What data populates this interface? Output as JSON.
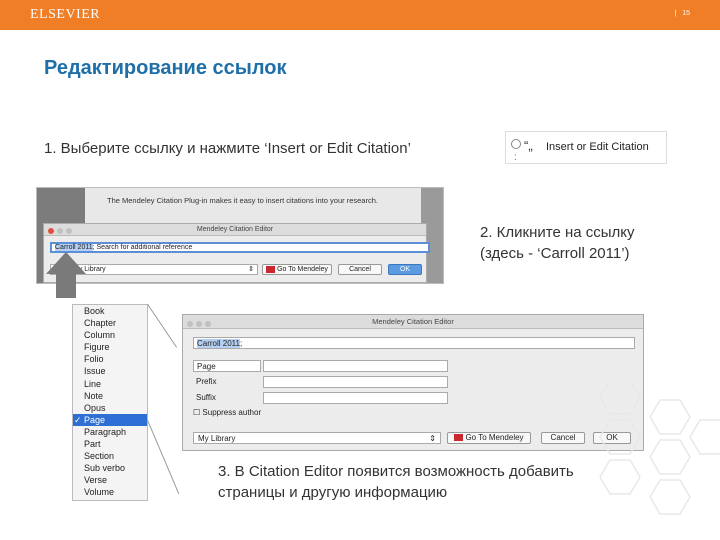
{
  "header": {
    "logo": "ELSEVIER",
    "pager_sep": "|",
    "page_number": "15"
  },
  "title": "Редактирование ссылок",
  "steps": {
    "step1": "1. Выберите ссылку и нажмите ‘Insert or Edit Citation’",
    "step2": "2. Кликните на ссылку (здесь - ‘Carroll 2011’)",
    "step3": "3. В Citation Editor появится возможность добавить страницы и другую информацию"
  },
  "toolbar_button": {
    "icon": "“„",
    "label": "Insert or Edit Citation",
    "sub": ":"
  },
  "screenshot1": {
    "intro": "The Mendeley Citation Plug-in makes it easy to insert citations into your research.",
    "window_title": "Mendeley Citation Editor",
    "input_value": "Carroll 2011",
    "input_placeholder": "; Search for additional reference",
    "library_value": "My Library",
    "goto_label": "Go To Mendeley",
    "cancel_label": "Cancel",
    "ok_label": "OK"
  },
  "locator_menu": {
    "items": [
      "Book",
      "Chapter",
      "Column",
      "Figure",
      "Folio",
      "Issue",
      "Line",
      "Note",
      "Opus",
      "Page",
      "Paragraph",
      "Part",
      "Section",
      "Sub verbo",
      "Verse",
      "Volume"
    ],
    "selected": "Page",
    "check": "✓"
  },
  "screenshot2": {
    "window_title": "Mendeley Citation Editor",
    "input_value": "Carroll 2011",
    "input_rest": ";",
    "locator_value": "Page",
    "prefix_label": "Prefix",
    "suffix_label": "Suffix",
    "suppress_label": "Suppress author",
    "library_value": "My Library",
    "goto_label": "Go To Mendeley",
    "cancel_label": "Cancel",
    "ok_label": "OK"
  },
  "colors": {
    "accent": "#f07e26",
    "title": "#1f6fa8",
    "selection": "#2e6fd6"
  }
}
